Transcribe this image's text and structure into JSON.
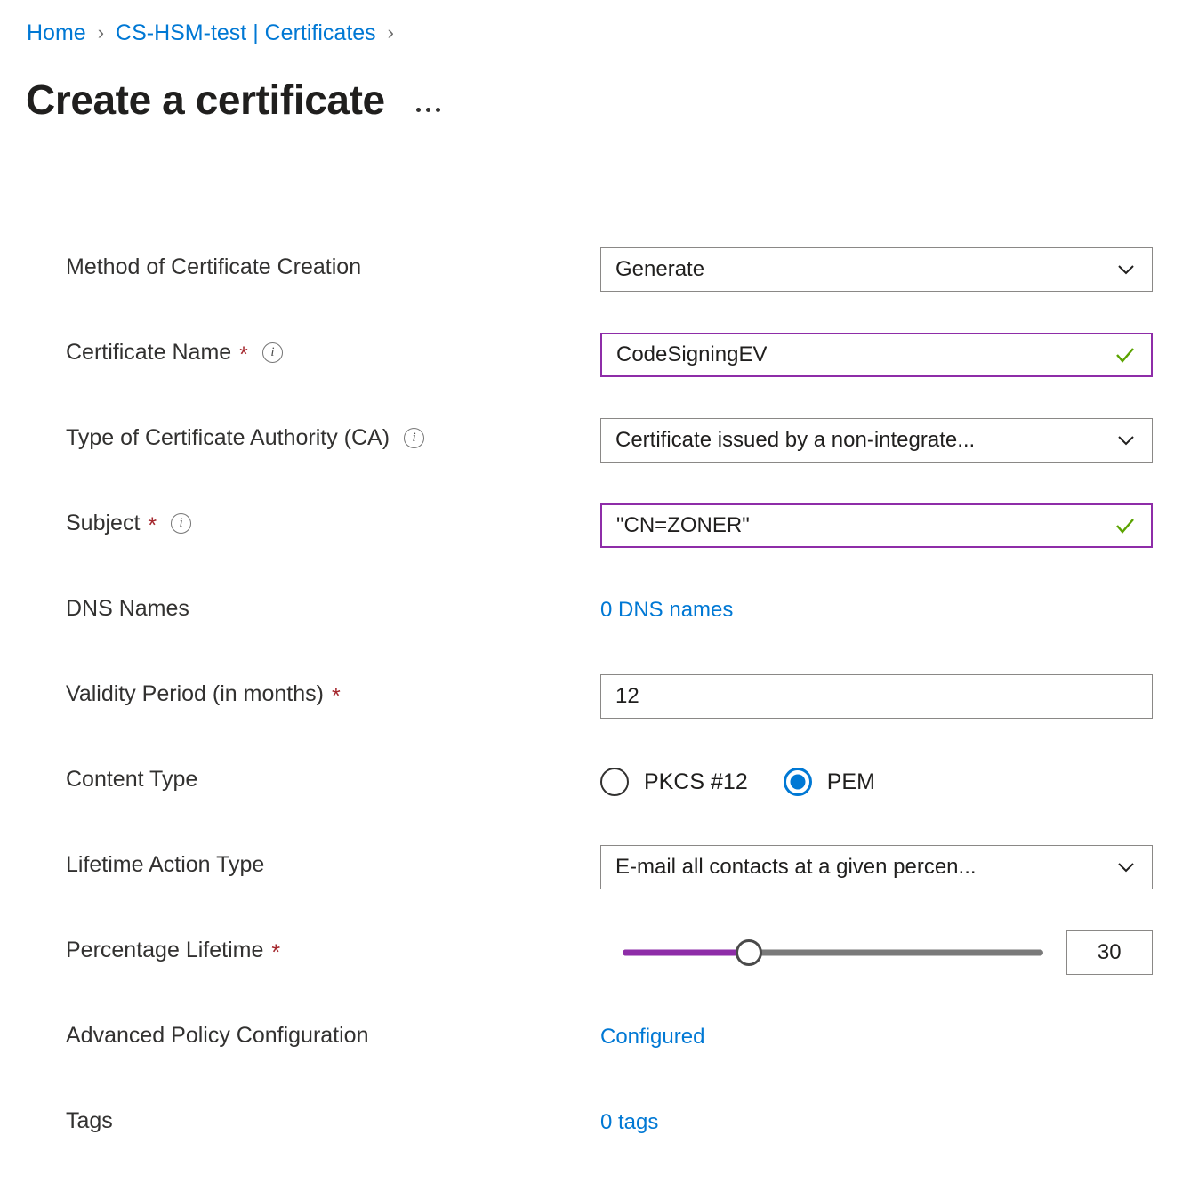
{
  "breadcrumb": {
    "items": [
      {
        "label": "Home"
      },
      {
        "label": "CS-HSM-test | Certificates"
      }
    ],
    "separator": "›"
  },
  "header": {
    "title": "Create a certificate",
    "more_label": "More options"
  },
  "colors": {
    "link": "#0078D4",
    "accent_purple": "#8E2DA8",
    "required_red": "#A4262C",
    "valid_green": "#5BA300",
    "radio_selected": "#0078D4"
  },
  "form": {
    "rows": [
      {
        "label": "Method of Certificate Creation",
        "required": false,
        "info": false,
        "control": "select",
        "value": "Generate"
      },
      {
        "label": "Certificate Name",
        "required": true,
        "info": true,
        "control": "text-valid",
        "value": "CodeSigningEV",
        "placeholder": "Certificate Name"
      },
      {
        "label": "Type of Certificate Authority (CA)",
        "required": false,
        "info": true,
        "control": "select",
        "value": "Certificate issued by a non-integrate..."
      },
      {
        "label": "Subject",
        "required": true,
        "info": true,
        "control": "text-valid",
        "value": "\"CN=ZONER\"",
        "placeholder": "Subject"
      },
      {
        "label": "DNS Names",
        "required": false,
        "info": false,
        "control": "link",
        "value": "0 DNS names"
      },
      {
        "label": "Validity Period (in months)",
        "required": true,
        "info": false,
        "control": "text",
        "value": "12",
        "placeholder": "Validity Period (in months)"
      },
      {
        "label": "Content Type",
        "required": false,
        "info": false,
        "control": "radio",
        "options": [
          {
            "label": "PKCS #12",
            "selected": false
          },
          {
            "label": "PEM",
            "selected": true
          }
        ]
      },
      {
        "label": "Lifetime Action Type",
        "required": false,
        "info": false,
        "control": "select",
        "value": "E-mail all contacts at a given percen..."
      },
      {
        "label": "Percentage Lifetime",
        "required": true,
        "info": false,
        "control": "slider",
        "value": "30",
        "percent": 30
      },
      {
        "label": "Advanced Policy Configuration",
        "required": false,
        "info": false,
        "control": "link",
        "value": "Configured"
      },
      {
        "label": "Tags",
        "required": false,
        "info": false,
        "control": "link",
        "value": "0 tags"
      }
    ]
  }
}
